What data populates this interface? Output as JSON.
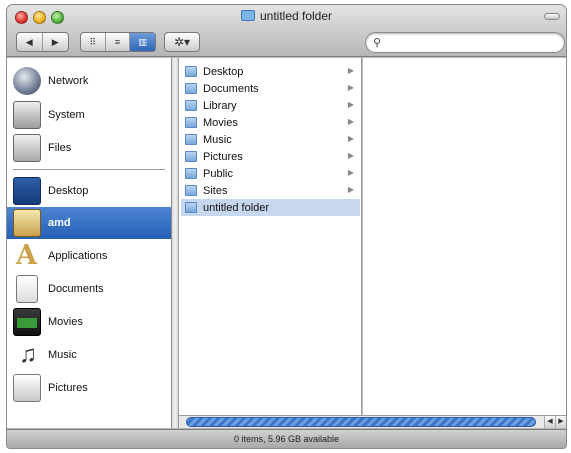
{
  "window": {
    "title": "untitled folder",
    "nav_back": "◀",
    "nav_forward": "▶",
    "views": [
      "⠿",
      "≡",
      "▥"
    ],
    "action_label": "✲▾"
  },
  "search": {
    "value": "",
    "placeholder": "",
    "icon": "search-icon"
  },
  "sidebar": {
    "devices": [
      {
        "label": "Network",
        "icon": "network-globe-icon"
      },
      {
        "label": "System",
        "icon": "hard-drive-icon"
      },
      {
        "label": "Files",
        "icon": "hard-drive-icon"
      }
    ],
    "places": [
      {
        "label": "Desktop",
        "icon": "desktop-icon"
      },
      {
        "label": "amd",
        "icon": "home-icon",
        "selected": true
      },
      {
        "label": "Applications",
        "icon": "applications-icon"
      },
      {
        "label": "Documents",
        "icon": "documents-icon"
      },
      {
        "label": "Movies",
        "icon": "movies-icon"
      },
      {
        "label": "Music",
        "icon": "music-icon"
      },
      {
        "label": "Pictures",
        "icon": "pictures-icon"
      }
    ]
  },
  "column1": {
    "items": [
      {
        "label": "Desktop",
        "has_children": true
      },
      {
        "label": "Documents",
        "has_children": true
      },
      {
        "label": "Library",
        "has_children": true
      },
      {
        "label": "Movies",
        "has_children": true
      },
      {
        "label": "Music",
        "has_children": true
      },
      {
        "label": "Pictures",
        "has_children": true
      },
      {
        "label": "Public",
        "has_children": true
      },
      {
        "label": "Sites",
        "has_children": true
      },
      {
        "label": "untitled folder",
        "has_children": false,
        "selected": true
      }
    ]
  },
  "status": {
    "text": "0 items, 5.96 GB available"
  },
  "colors": {
    "selection": "#2f66b8",
    "row_selection": "#c7d7ef"
  }
}
